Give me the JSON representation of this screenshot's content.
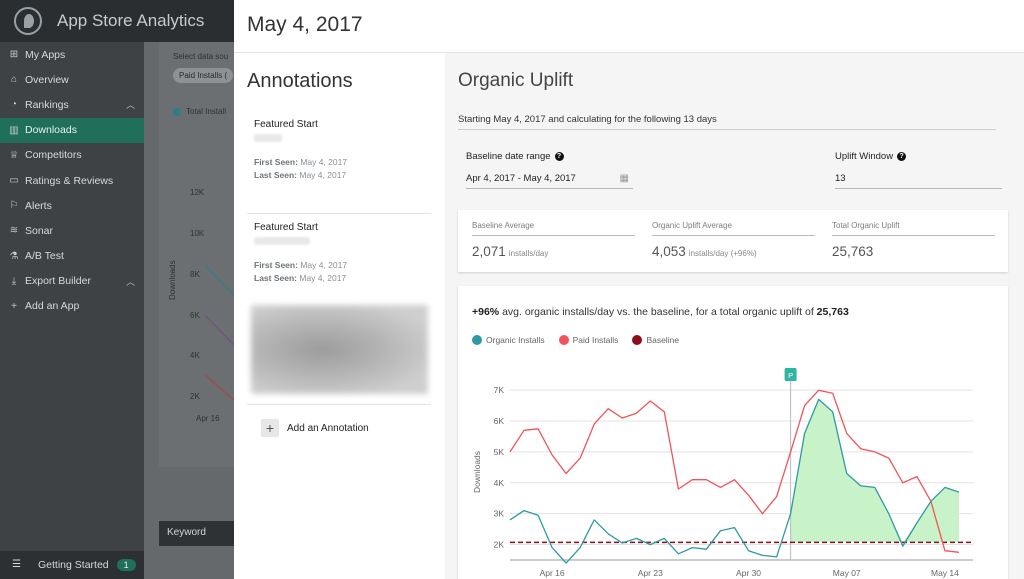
{
  "app": {
    "title": "App Store Analytics"
  },
  "sidebar": {
    "items": [
      {
        "label": "My Apps",
        "icon": "grid-icon"
      },
      {
        "label": "Overview",
        "icon": "home-icon"
      },
      {
        "label": "Rankings",
        "icon": "gauge-icon",
        "expanded": true
      },
      {
        "label": "Downloads",
        "icon": "bar-chart-icon",
        "active": true
      },
      {
        "label": "Competitors",
        "icon": "trophy-icon"
      },
      {
        "label": "Ratings & Reviews",
        "icon": "comment-icon"
      },
      {
        "label": "Alerts",
        "icon": "flag-icon"
      },
      {
        "label": "Sonar",
        "icon": "sonar-icon"
      },
      {
        "label": "A/B Test",
        "icon": "flask-icon"
      },
      {
        "label": "Export Builder",
        "icon": "download-icon",
        "expanded": true
      },
      {
        "label": "Add an App",
        "icon": "plus-icon"
      }
    ],
    "getting_started": {
      "label": "Getting Started",
      "count": "1"
    }
  },
  "background": {
    "select_label": "Select data sou",
    "chip": "Paid Installs (",
    "legend": "Total Install",
    "y_ticks": [
      "12K",
      "10K",
      "8K",
      "6K",
      "4K",
      "2K"
    ],
    "y_label": "Downloads",
    "x_tick": "Apr 16",
    "keyword_header": "Keyword"
  },
  "drawer": {
    "title": "May 4, 2017",
    "annotations": {
      "heading": "Annotations",
      "items": [
        {
          "name": "Featured Start",
          "first_seen_label": "First Seen:",
          "first_seen": "May 4, 2017",
          "last_seen_label": "Last Seen:",
          "last_seen": "May 4, 2017"
        },
        {
          "name": "Featured Start",
          "first_seen_label": "First Seen:",
          "first_seen": "May 4, 2017",
          "last_seen_label": "Last Seen:",
          "last_seen": "May 4, 2017"
        }
      ],
      "add_label": "Add an Annotation"
    },
    "uplift": {
      "heading": "Organic Uplift",
      "starting_text": "Starting May 4, 2017 and calculating for the following 13 days",
      "baseline_label": "Baseline date range",
      "baseline_value": "Apr 4, 2017 - May 4, 2017",
      "window_label": "Uplift Window",
      "window_value": "13",
      "stats": {
        "baseline_avg_label": "Baseline Average",
        "baseline_avg_value": "2,071",
        "baseline_avg_unit": "installs/day",
        "organic_avg_label": "Organic Uplift Average",
        "organic_avg_value": "4,053",
        "organic_avg_unit": "installs/day (+96%)",
        "total_label": "Total Organic Uplift",
        "total_value": "25,763"
      },
      "summary": {
        "pct": "+96%",
        "text": " avg. organic installs/day vs. the baseline, for a total organic uplift of ",
        "total": "25,763"
      }
    }
  },
  "colors": {
    "organic": "#2e9aa6",
    "paid": "#f0545a",
    "baseline": "#8b0e1a",
    "uplift_fill": "#c8f2c8",
    "active_nav": "#1f6f5a"
  },
  "chart_data": {
    "type": "line",
    "x": [
      "Apr 13",
      "Apr 14",
      "Apr 15",
      "Apr 16",
      "Apr 17",
      "Apr 18",
      "Apr 19",
      "Apr 20",
      "Apr 21",
      "Apr 22",
      "Apr 23",
      "Apr 24",
      "Apr 25",
      "Apr 26",
      "Apr 27",
      "Apr 28",
      "Apr 29",
      "Apr 30",
      "May 01",
      "May 02",
      "May 03",
      "May 04",
      "May 05",
      "May 06",
      "May 07",
      "May 08",
      "May 09",
      "May 10",
      "May 11",
      "May 12",
      "May 13",
      "May 14",
      "May 15",
      "May 16"
    ],
    "x_tick_labels": [
      "Apr 16",
      "Apr 23",
      "Apr 30",
      "May 07",
      "May 14"
    ],
    "x_tick_indices": [
      3,
      10,
      17,
      24,
      31
    ],
    "y_ticks": [
      2000,
      3000,
      4000,
      5000,
      6000,
      7000
    ],
    "y_tick_labels": [
      "2K",
      "3K",
      "4K",
      "5K",
      "6K",
      "7K"
    ],
    "ylim": [
      1500,
      7200
    ],
    "ylabel": "Downloads",
    "series": [
      {
        "name": "Organic Installs",
        "color": "#2e9aa6",
        "values": [
          2800,
          3100,
          2950,
          1900,
          1400,
          1900,
          2800,
          2350,
          2050,
          2200,
          2000,
          2200,
          1700,
          1900,
          1850,
          2450,
          2550,
          1800,
          1650,
          1600,
          3000,
          5600,
          6700,
          6300,
          4300,
          3900,
          3850,
          3000,
          1950,
          2700,
          3400,
          3850,
          3700
        ]
      },
      {
        "name": "Paid Installs",
        "color": "#f0545a",
        "values": [
          5000,
          5700,
          5750,
          4900,
          4300,
          4800,
          5900,
          6400,
          6100,
          6250,
          6650,
          6300,
          3800,
          4100,
          4100,
          3850,
          4100,
          3600,
          3000,
          3550,
          5000,
          6500,
          7000,
          6900,
          5600,
          5100,
          5000,
          4800,
          4000,
          4200,
          3400,
          1800,
          1750
        ]
      },
      {
        "name": "Baseline",
        "color": "#8b0e1a",
        "values": [
          2071,
          2071
        ]
      }
    ],
    "marker": {
      "label": "P",
      "index": 20
    },
    "uplift_range": [
      20,
      32
    ]
  }
}
